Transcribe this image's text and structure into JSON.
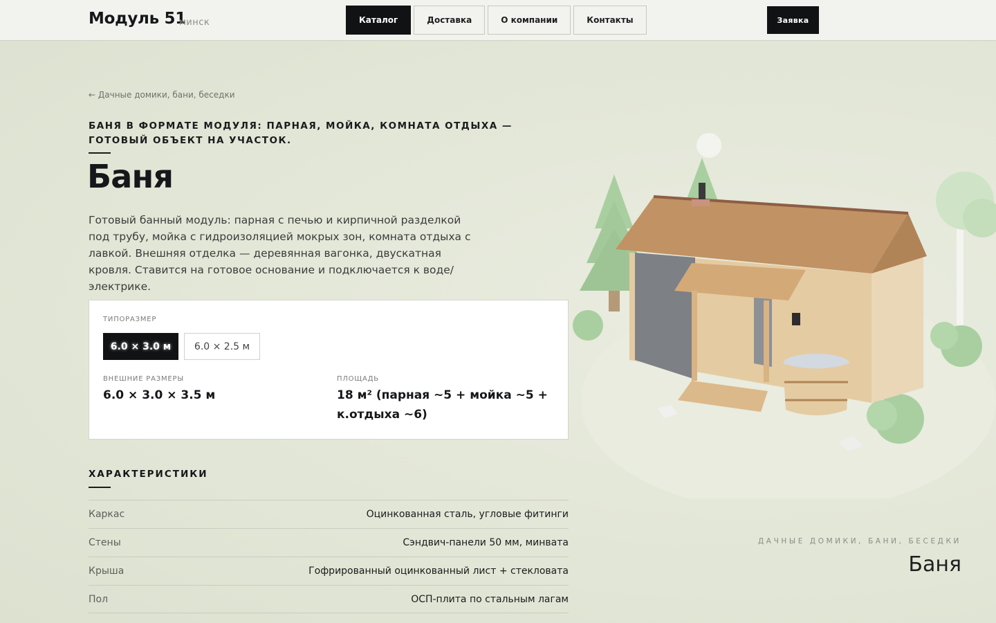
{
  "header": {
    "logo": "Модуль 51",
    "city": "минск",
    "nav": [
      "Каталог",
      "Доставка",
      "О компании",
      "Контакты"
    ],
    "order_label": "Заявка"
  },
  "breadcrumb": "← Дачные домики, бани, беседки",
  "eyebrow": "БАНЯ В ФОРМАТЕ МОДУЛЯ: ПАРНАЯ, МОЙКА, КОМНАТА ОТДЫХА — ГОТОВЫЙ ОБЪЕКТ НА УЧАСТОК.",
  "title": "Баня",
  "description": "Готовый банный модуль: парная с печью и кирпичной разделкой под трубу, мойка с гидроизоляцией мокрых зон, комната отдыха с лавкой. Внешняя отделка — деревянная вагонка, двускатная кровля. Ставится на готовое основание и подключается к воде/электрике.",
  "card": {
    "size_label": "ТИПОРАЗМЕР",
    "sizes": [
      "6.0 × 3.0 м",
      "6.0 × 2.5 м"
    ],
    "selected_size": "6.0 × 3.0 м",
    "dims_label": "ВНЕШНИЕ РАЗМЕРЫ",
    "dims_value": "6.0 × 3.0 × 3.5 м",
    "area_label": "ПЛОЩАДЬ",
    "area_value_line1": "18 м² (парная ~5 + мойка ~5 +",
    "area_value_line2": "к.отдыха ~6)"
  },
  "specs": {
    "heading": "ХАРАКТЕРИСТИКИ",
    "rows": [
      {
        "key": "Каркас",
        "value": "Оцинкованная сталь, угловые фитинги"
      },
      {
        "key": "Стены",
        "value": "Сэндвич-панели 50 мм, минвата"
      },
      {
        "key": "Крыша",
        "value": "Гофрированный оцинкованный лист + стекловата"
      },
      {
        "key": "Пол",
        "value": "ОСП-плита по стальным лагам"
      }
    ]
  },
  "caption": {
    "category": "ДАЧНЫЕ ДОМИКИ, БАНИ, БЕСЕДКИ",
    "title": "Баня"
  },
  "colors": {
    "accent": "#111214",
    "background": "#e4e7d9",
    "wood": "#d9b98c",
    "roof": "#b8875a",
    "foliage": "#a9cfa0"
  }
}
